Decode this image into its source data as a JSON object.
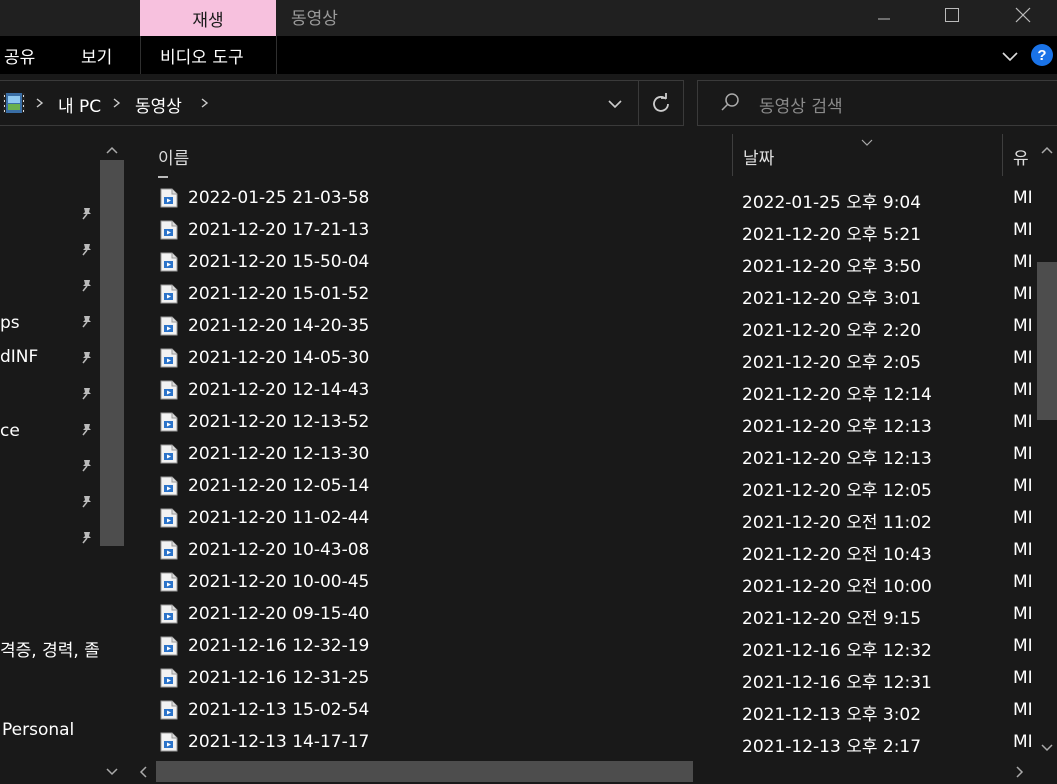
{
  "window": {
    "play_tab": "재생",
    "title": "동영상"
  },
  "ribbon": {
    "items": [
      "공유",
      "보기",
      "비디오 도구"
    ]
  },
  "address": {
    "crumbs": [
      "내 PC",
      "동영상"
    ]
  },
  "search": {
    "placeholder": "동영상 검색"
  },
  "nav": {
    "items": [
      "ps",
      "dINF",
      "ce",
      "격증, 경력, 졸",
      "Personal"
    ]
  },
  "columns": {
    "name": "이름",
    "date": "날짜",
    "type": "유"
  },
  "files": [
    {
      "name": "2022-01-25 21-03-58",
      "date": "2022-01-25 오후 9:04",
      "type": "MI"
    },
    {
      "name": "2021-12-20 17-21-13",
      "date": "2021-12-20 오후 5:21",
      "type": "MI"
    },
    {
      "name": "2021-12-20 15-50-04",
      "date": "2021-12-20 오후 3:50",
      "type": "MI"
    },
    {
      "name": "2021-12-20 15-01-52",
      "date": "2021-12-20 오후 3:01",
      "type": "MI"
    },
    {
      "name": "2021-12-20 14-20-35",
      "date": "2021-12-20 오후 2:20",
      "type": "MI"
    },
    {
      "name": "2021-12-20 14-05-30",
      "date": "2021-12-20 오후 2:05",
      "type": "MI"
    },
    {
      "name": "2021-12-20 12-14-43",
      "date": "2021-12-20 오후 12:14",
      "type": "MI"
    },
    {
      "name": "2021-12-20 12-13-52",
      "date": "2021-12-20 오후 12:13",
      "type": "MI"
    },
    {
      "name": "2021-12-20 12-13-30",
      "date": "2021-12-20 오후 12:13",
      "type": "MI"
    },
    {
      "name": "2021-12-20 12-05-14",
      "date": "2021-12-20 오후 12:05",
      "type": "MI"
    },
    {
      "name": "2021-12-20 11-02-44",
      "date": "2021-12-20 오전 11:02",
      "type": "MI"
    },
    {
      "name": "2021-12-20 10-43-08",
      "date": "2021-12-20 오전 10:43",
      "type": "MI"
    },
    {
      "name": "2021-12-20 10-00-45",
      "date": "2021-12-20 오전 10:00",
      "type": "MI"
    },
    {
      "name": "2021-12-20 09-15-40",
      "date": "2021-12-20 오전 9:15",
      "type": "MI"
    },
    {
      "name": "2021-12-16 12-32-19",
      "date": "2021-12-16 오후 12:32",
      "type": "MI"
    },
    {
      "name": "2021-12-16 12-31-25",
      "date": "2021-12-16 오후 12:31",
      "type": "MI"
    },
    {
      "name": "2021-12-13 15-02-54",
      "date": "2021-12-13 오후 3:02",
      "type": "MI"
    },
    {
      "name": "2021-12-13 14-17-17",
      "date": "2021-12-13 오후 2:17",
      "type": "MI"
    }
  ],
  "colors": {
    "play_tab_bg": "#f7c1de",
    "help_blue": "#1a73e8"
  }
}
